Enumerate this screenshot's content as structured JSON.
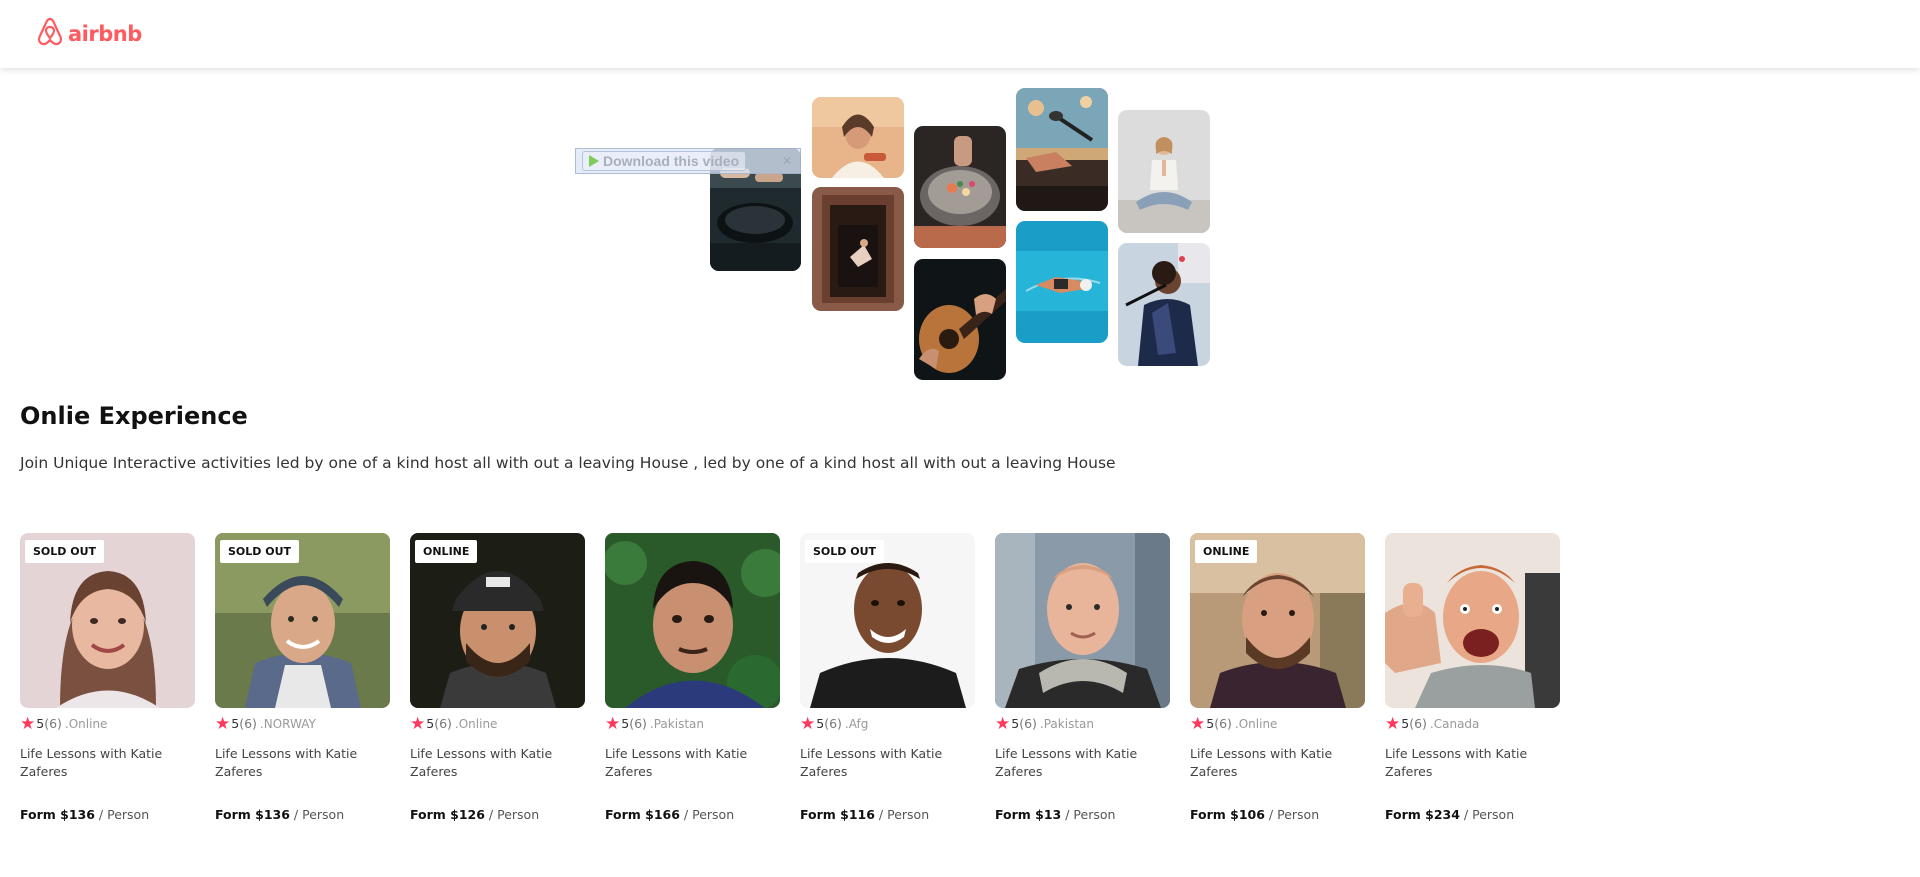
{
  "header": {
    "brand_name": "airbnb",
    "brand_color": "#FF5A5F",
    "logo_icon": "airbnb-belo-icon"
  },
  "collage": {
    "download_overlay": {
      "label": "Download this video",
      "play_icon": "play-icon",
      "close_icon": "close-icon"
    },
    "photos": [
      {
        "id": "cooking-pans",
        "subject": "cooking with pans"
      },
      {
        "id": "chef-woman",
        "subject": "smiling woman chef"
      },
      {
        "id": "doorway-dancer",
        "subject": "dancer in doorway"
      },
      {
        "id": "food-bowl",
        "subject": "plated food in bowl"
      },
      {
        "id": "guitar",
        "subject": "acoustic guitar"
      },
      {
        "id": "piano-mic",
        "subject": "piano and microphone"
      },
      {
        "id": "swimmer",
        "subject": "swimmer in pool"
      },
      {
        "id": "yoga",
        "subject": "yoga meditation"
      },
      {
        "id": "singer",
        "subject": "singer with microphone"
      }
    ]
  },
  "section": {
    "title": "Onlie Experience",
    "description": "Join Unique Interactive activities led by one of a kind host all with out a leaving House , led by one of a kind host all with out a leaving House"
  },
  "cards": [
    {
      "badge": "SOLD OUT",
      "rating": "5",
      "count": "(6)",
      "location": ".Online",
      "title": "Life Lessons with Katie Zaferes",
      "price": "Form $136",
      "per": " / Person",
      "photo": "woman-brown-hair"
    },
    {
      "badge": "SOLD OUT",
      "rating": "5",
      "count": "(6)",
      "location": ".NORWAY",
      "title": "Life Lessons with Katie Zaferes",
      "price": "Form $136",
      "per": " / Person",
      "photo": "man-cap-plaid"
    },
    {
      "badge": "ONLINE",
      "rating": "5",
      "count": "(6)",
      "location": ".Online",
      "title": "Life Lessons with Katie Zaferes",
      "price": "Form $126",
      "per": " / Person",
      "photo": "bearded-man-cap"
    },
    {
      "badge": "",
      "rating": "5",
      "count": "(6)",
      "location": ".Pakistan",
      "title": "Life Lessons with Katie Zaferes",
      "price": "Form $166",
      "per": " / Person",
      "photo": "man-leaves"
    },
    {
      "badge": "SOLD OUT",
      "rating": "5",
      "count": "(6)",
      "location": ".Afg",
      "title": "Life Lessons with Katie Zaferes",
      "price": "Form $116",
      "per": " / Person",
      "photo": "smiling-man-white-bg"
    },
    {
      "badge": "",
      "rating": "5",
      "count": "(6)",
      "location": ".Pakistan",
      "title": "Life Lessons with Katie Zaferes",
      "price": "Form $13",
      "per": " / Person",
      "photo": "man-scarf"
    },
    {
      "badge": "ONLINE",
      "rating": "5",
      "count": "(6)",
      "location": ".Online",
      "title": "Life Lessons with Katie Zaferes",
      "price": "Form $106",
      "per": " / Person",
      "photo": "bearded-man-outdoor"
    },
    {
      "badge": "",
      "rating": "5",
      "count": "(6)",
      "location": ".Canada",
      "title": "Life Lessons with Katie Zaferes",
      "price": "Form $234",
      "per": " / Person",
      "photo": "excited-man-thumbs-up"
    }
  ],
  "colors": {
    "accent": "#FF5A5F",
    "star": "#ff385c"
  }
}
